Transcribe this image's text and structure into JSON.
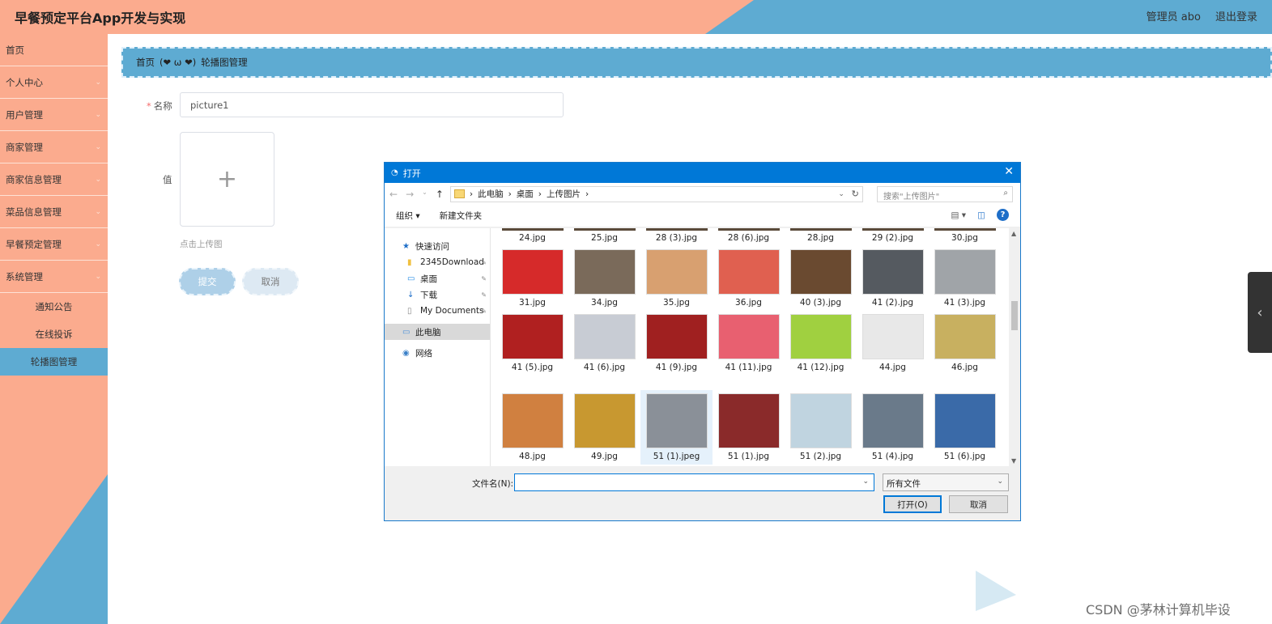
{
  "header": {
    "title": "早餐预定平台App开发与实现",
    "admin": "管理员 abo",
    "logout": "退出登录"
  },
  "sidebar": {
    "items": [
      {
        "label": "首页",
        "chevron": false
      },
      {
        "label": "个人中心",
        "chevron": true
      },
      {
        "label": "用户管理",
        "chevron": true
      },
      {
        "label": "商家管理",
        "chevron": true
      },
      {
        "label": "商家信息管理",
        "chevron": true
      },
      {
        "label": "菜品信息管理",
        "chevron": true
      },
      {
        "label": "早餐预定管理",
        "chevron": true
      },
      {
        "label": "系统管理",
        "chevron": true
      }
    ],
    "subitems": [
      {
        "label": "通知公告"
      },
      {
        "label": "在线投诉"
      },
      {
        "label": "轮播图管理",
        "active": true
      }
    ]
  },
  "breadcrumb": {
    "home": "首页",
    "emoji": "(❤ ω ❤)",
    "current": "轮播图管理"
  },
  "form": {
    "name_label": "名称",
    "name_value": "picture1",
    "value_label": "值",
    "upload_plus": "+",
    "upload_hint": "点击上传图",
    "submit": "提交",
    "cancel": "取消"
  },
  "dialog": {
    "title": "打开",
    "path": [
      "此电脑",
      "桌面",
      "上传图片"
    ],
    "search_placeholder": "搜索\"上传图片\"",
    "toolbar": {
      "organize": "组织 ▾",
      "new_folder": "新建文件夹"
    },
    "tree": [
      {
        "label": "快速访问",
        "icon": "star-icon",
        "pinned": false,
        "indent": false
      },
      {
        "label": "2345Download",
        "icon": "folder-icon",
        "pinned": true,
        "indent": true
      },
      {
        "label": "桌面",
        "icon": "desktop-icon",
        "pinned": true,
        "indent": true
      },
      {
        "label": "下载",
        "icon": "download-icon",
        "pinned": true,
        "indent": true
      },
      {
        "label": "My Documents",
        "icon": "document-icon",
        "pinned": true,
        "indent": true
      },
      {
        "label": "此电脑",
        "icon": "computer-icon",
        "pinned": false,
        "indent": false,
        "selected": true
      },
      {
        "label": "网络",
        "icon": "network-icon",
        "pinned": false,
        "indent": false
      }
    ],
    "files_row0": [
      "24.jpg",
      "25.jpg",
      "28 (3).jpg",
      "28 (6).jpg",
      "28.jpg",
      "29 (2).jpg",
      "30.jpg"
    ],
    "files": [
      {
        "name": "31.jpg",
        "color": "#d62a2a"
      },
      {
        "name": "34.jpg",
        "color": "#7a6a5a"
      },
      {
        "name": "35.jpg",
        "color": "#d8a070"
      },
      {
        "name": "36.jpg",
        "color": "#e06050"
      },
      {
        "name": "40 (3).jpg",
        "color": "#6a4a30"
      },
      {
        "name": "41 (2).jpg",
        "color": "#555a60"
      },
      {
        "name": "41 (3).jpg",
        "color": "#a0a4a8"
      },
      {
        "name": "41 (5).jpg",
        "color": "#b02020"
      },
      {
        "name": "41 (6).jpg",
        "color": "#c8ccd4"
      },
      {
        "name": "41 (9).jpg",
        "color": "#a02020"
      },
      {
        "name": "41 (11).jpg",
        "color": "#e86070"
      },
      {
        "name": "41 (12).jpg",
        "color": "#a0d040"
      },
      {
        "name": "44.jpg",
        "color": "#e8e8e8"
      },
      {
        "name": "46.jpg",
        "color": "#c8b060"
      },
      {
        "name": "48.jpg",
        "color": "#d08040"
      },
      {
        "name": "49.jpg",
        "color": "#c89830"
      },
      {
        "name": "51 (1).jpeg",
        "color": "#8a9098",
        "selected": true
      },
      {
        "name": "51 (1).jpg",
        "color": "#8a2a2a"
      },
      {
        "name": "51 (2).jpg",
        "color": "#c0d4e0"
      },
      {
        "name": "51 (4).jpg",
        "color": "#6a7a8a"
      },
      {
        "name": "51 (6).jpg",
        "color": "#3a6aa8"
      }
    ],
    "filename_label": "文件名(N):",
    "filename_value": "",
    "filetype": "所有文件",
    "open": "打开(O)",
    "cancel": "取消"
  },
  "watermark": "CSDN @茅林计算机毕设"
}
